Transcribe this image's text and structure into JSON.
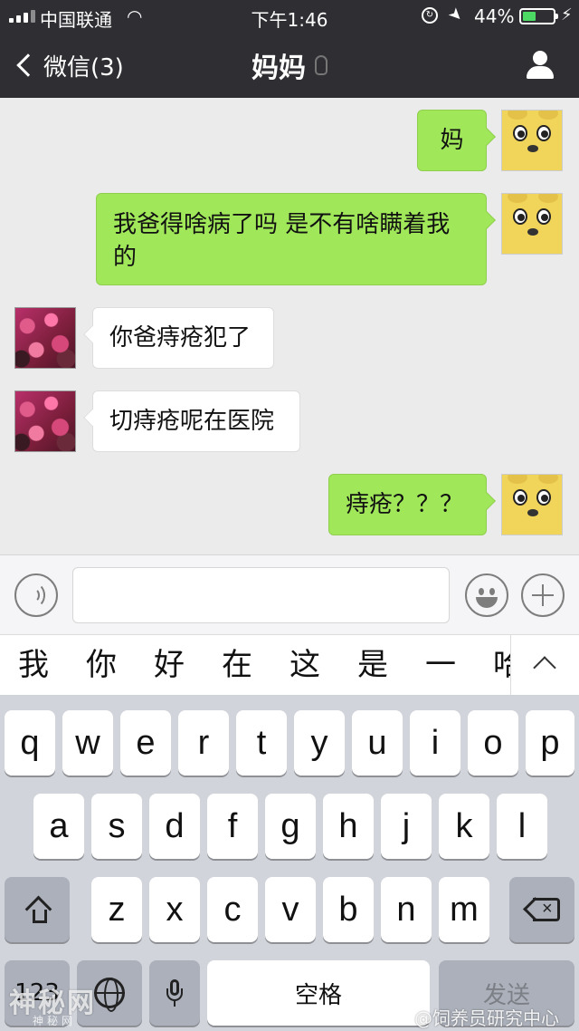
{
  "status_bar": {
    "carrier": "中国联通",
    "wifi_icon": "wifi-icon",
    "time": "下午1:46",
    "battery_percent": "44%",
    "battery_level": 0.44
  },
  "nav": {
    "back_label": "微信(3)",
    "title": "妈妈",
    "right_icon": "profile-icon"
  },
  "messages": [
    {
      "from": "self",
      "text": "妈"
    },
    {
      "from": "self",
      "text": "我爸得啥病了吗 是不有啥瞒着我的"
    },
    {
      "from": "mom",
      "text": "你爸痔疮犯了"
    },
    {
      "from": "mom",
      "text": "切痔疮呢在医院"
    },
    {
      "from": "self",
      "text": "痔疮？？？"
    }
  ],
  "input_bar": {
    "value": "",
    "left_icon": "voice-icon",
    "emoji_icon": "emoji-icon",
    "plus_icon": "plus-icon"
  },
  "candidates": [
    "我",
    "你",
    "好",
    "在",
    "这",
    "是",
    "一",
    "哈"
  ],
  "keyboard": {
    "row1": [
      "q",
      "w",
      "e",
      "r",
      "t",
      "y",
      "u",
      "i",
      "o",
      "p"
    ],
    "row2": [
      "a",
      "s",
      "d",
      "f",
      "g",
      "h",
      "j",
      "k",
      "l"
    ],
    "row3": [
      "z",
      "x",
      "c",
      "v",
      "b",
      "n",
      "m"
    ],
    "numbers_key": "123",
    "space_label": "空格",
    "send_label": "发送"
  },
  "watermarks": {
    "left": "神秘网",
    "left_sub": "神秘网",
    "right": "@饲养员研究中心"
  }
}
